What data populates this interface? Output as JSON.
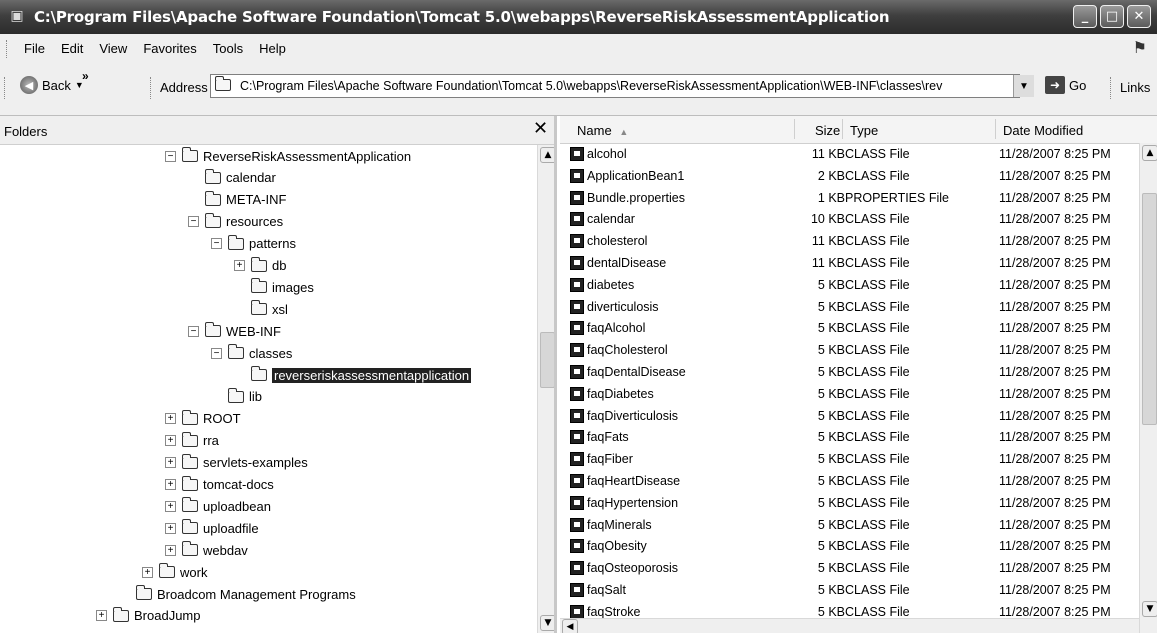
{
  "window": {
    "title": "C:\\Program Files\\Apache Software Foundation\\Tomcat 5.0\\webapps\\ReverseRiskAssessmentApplication",
    "minimize_glyph": "_",
    "maximize_glyph": "□",
    "close_glyph": "✕"
  },
  "menu": {
    "items": [
      "File",
      "Edit",
      "View",
      "Favorites",
      "Tools",
      "Help"
    ]
  },
  "toolbar": {
    "back_label": "Back",
    "chevron": "»",
    "address_label": "Address",
    "address_value": "C:\\Program Files\\Apache Software Foundation\\Tomcat 5.0\\webapps\\ReverseRiskAssessmentApplication\\WEB-INF\\classes\\rev",
    "go_label": "Go",
    "links_label": "Links"
  },
  "folders": {
    "header": "Folders",
    "close": "✕",
    "tree": [
      {
        "label": "ReverseRiskAssessmentApplication",
        "level": 0,
        "toggle": "minus",
        "selected": false
      },
      {
        "label": "calendar",
        "level": 1,
        "toggle": "none",
        "selected": false
      },
      {
        "label": "META-INF",
        "level": 1,
        "toggle": "none",
        "selected": false
      },
      {
        "label": "resources",
        "level": 1,
        "toggle": "minus",
        "selected": false
      },
      {
        "label": "patterns",
        "level": 2,
        "toggle": "minus",
        "selected": false
      },
      {
        "label": "db",
        "level": 3,
        "toggle": "plus",
        "selected": false
      },
      {
        "label": "images",
        "level": 3,
        "toggle": "none",
        "selected": false
      },
      {
        "label": "xsl",
        "level": 3,
        "toggle": "none",
        "selected": false
      },
      {
        "label": "WEB-INF",
        "level": 1,
        "toggle": "minus",
        "selected": false
      },
      {
        "label": "classes",
        "level": 2,
        "toggle": "minus",
        "selected": false
      },
      {
        "label": "reverseriskassessmentapplication",
        "level": 3,
        "toggle": "none",
        "selected": true
      },
      {
        "label": "lib",
        "level": 2,
        "toggle": "none",
        "selected": false
      },
      {
        "label": "ROOT",
        "level": 0,
        "toggle": "plus",
        "selected": false
      },
      {
        "label": "rra",
        "level": 0,
        "toggle": "plus",
        "selected": false
      },
      {
        "label": "servlets-examples",
        "level": 0,
        "toggle": "plus",
        "selected": false
      },
      {
        "label": "tomcat-docs",
        "level": 0,
        "toggle": "plus",
        "selected": false
      },
      {
        "label": "uploadbean",
        "level": 0,
        "toggle": "plus",
        "selected": false
      },
      {
        "label": "uploadfile",
        "level": 0,
        "toggle": "plus",
        "selected": false
      },
      {
        "label": "webdav",
        "level": 0,
        "toggle": "plus",
        "selected": false
      },
      {
        "label": "work",
        "level": -1,
        "toggle": "plus",
        "selected": false
      },
      {
        "label": "Broadcom Management Programs",
        "level": -2,
        "toggle": "none",
        "selected": false
      },
      {
        "label": "BroadJump",
        "level": -3,
        "toggle": "plus",
        "selected": false
      }
    ]
  },
  "files": {
    "columns": {
      "name": "Name",
      "size": "Size",
      "type": "Type",
      "date": "Date Modified"
    },
    "sort_indicator": "▲",
    "rows": [
      {
        "name": "alcohol",
        "size": "11 KB",
        "type": "CLASS File",
        "date": "11/28/2007 8:25 PM"
      },
      {
        "name": "ApplicationBean1",
        "size": "2 KB",
        "type": "CLASS File",
        "date": "11/28/2007 8:25 PM"
      },
      {
        "name": "Bundle.properties",
        "size": "1 KB",
        "type": "PROPERTIES File",
        "date": "11/28/2007 8:25 PM"
      },
      {
        "name": "calendar",
        "size": "10 KB",
        "type": "CLASS File",
        "date": "11/28/2007 8:25 PM"
      },
      {
        "name": "cholesterol",
        "size": "11 KB",
        "type": "CLASS File",
        "date": "11/28/2007 8:25 PM"
      },
      {
        "name": "dentalDisease",
        "size": "11 KB",
        "type": "CLASS File",
        "date": "11/28/2007 8:25 PM"
      },
      {
        "name": "diabetes",
        "size": "5 KB",
        "type": "CLASS File",
        "date": "11/28/2007 8:25 PM"
      },
      {
        "name": "diverticulosis",
        "size": "5 KB",
        "type": "CLASS File",
        "date": "11/28/2007 8:25 PM"
      },
      {
        "name": "faqAlcohol",
        "size": "5 KB",
        "type": "CLASS File",
        "date": "11/28/2007 8:25 PM"
      },
      {
        "name": "faqCholesterol",
        "size": "5 KB",
        "type": "CLASS File",
        "date": "11/28/2007 8:25 PM"
      },
      {
        "name": "faqDentalDisease",
        "size": "5 KB",
        "type": "CLASS File",
        "date": "11/28/2007 8:25 PM"
      },
      {
        "name": "faqDiabetes",
        "size": "5 KB",
        "type": "CLASS File",
        "date": "11/28/2007 8:25 PM"
      },
      {
        "name": "faqDiverticulosis",
        "size": "5 KB",
        "type": "CLASS File",
        "date": "11/28/2007 8:25 PM"
      },
      {
        "name": "faqFats",
        "size": "5 KB",
        "type": "CLASS File",
        "date": "11/28/2007 8:25 PM"
      },
      {
        "name": "faqFiber",
        "size": "5 KB",
        "type": "CLASS File",
        "date": "11/28/2007 8:25 PM"
      },
      {
        "name": "faqHeartDisease",
        "size": "5 KB",
        "type": "CLASS File",
        "date": "11/28/2007 8:25 PM"
      },
      {
        "name": "faqHypertension",
        "size": "5 KB",
        "type": "CLASS File",
        "date": "11/28/2007 8:25 PM"
      },
      {
        "name": "faqMinerals",
        "size": "5 KB",
        "type": "CLASS File",
        "date": "11/28/2007 8:25 PM"
      },
      {
        "name": "faqObesity",
        "size": "5 KB",
        "type": "CLASS File",
        "date": "11/28/2007 8:25 PM"
      },
      {
        "name": "faqOsteoporosis",
        "size": "5 KB",
        "type": "CLASS File",
        "date": "11/28/2007 8:25 PM"
      },
      {
        "name": "faqSalt",
        "size": "5 KB",
        "type": "CLASS File",
        "date": "11/28/2007 8:25 PM"
      },
      {
        "name": "faqStroke",
        "size": "5 KB",
        "type": "CLASS File",
        "date": "11/28/2007 8:25 PM"
      }
    ]
  },
  "colors": {
    "titlebar": "#3f3f3f",
    "selection": "#222222"
  }
}
